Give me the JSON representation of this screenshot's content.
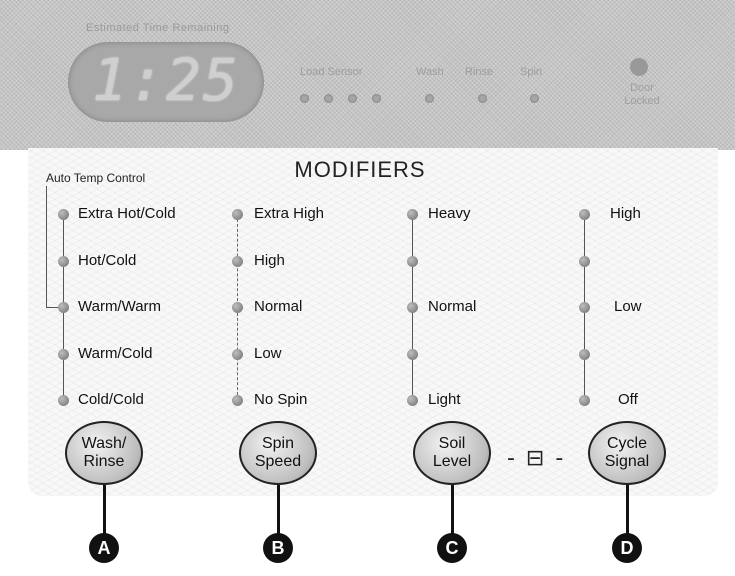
{
  "display": {
    "estimated_time_label": "Estimated Time Remaining",
    "time_value": "1:25",
    "status_labels": {
      "load_sensor": "Load Sensor",
      "wash": "Wash",
      "rinse": "Rinse",
      "spin": "Spin"
    },
    "door_locked_label": "Door\nLocked"
  },
  "modifiers": {
    "title": "MODIFIERS",
    "auto_temp_label": "Auto Temp Control",
    "wash_rinse": {
      "options": [
        "Extra Hot/Cold",
        "Hot/Cold",
        "Warm/Warm",
        "Warm/Cold",
        "Cold/Cold"
      ],
      "button": "Wash/\nRinse",
      "marker": "A"
    },
    "spin_speed": {
      "options": [
        "Extra High",
        "High",
        "Normal",
        "Low",
        "No Spin"
      ],
      "button": "Spin\nSpeed",
      "marker": "B"
    },
    "soil_level": {
      "options": [
        "Heavy",
        "",
        "Normal",
        "",
        "Light"
      ],
      "button": "Soil\nLevel",
      "marker": "C"
    },
    "cycle_signal": {
      "options": [
        "High",
        "",
        "Low",
        "",
        "Off"
      ],
      "button": "Cycle\nSignal",
      "marker": "D"
    },
    "lock_symbol": "- ⊟ -"
  }
}
